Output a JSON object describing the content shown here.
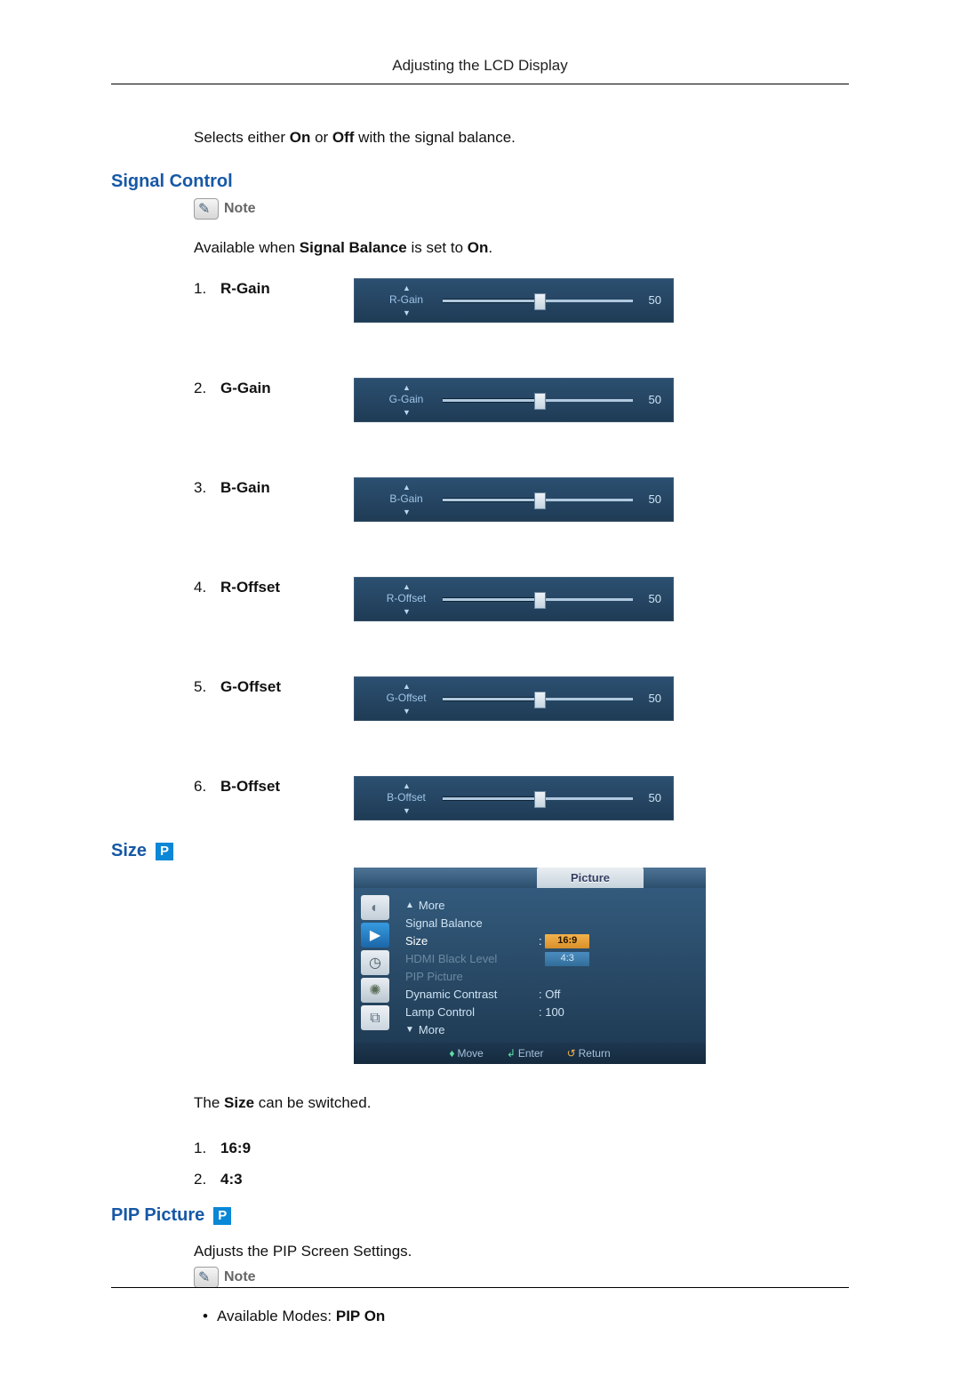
{
  "header": {
    "title": "Adjusting the LCD Display"
  },
  "intro": {
    "prefix": "Selects either ",
    "on": "On",
    "mid": " or ",
    "off": "Off",
    "suffix": " with the signal balance."
  },
  "signal_control": {
    "heading": "Signal Control",
    "note_label": "Note",
    "avail_prefix": "Available when ",
    "avail_bold": "Signal Balance",
    "avail_mid": " is set to ",
    "avail_on": "On",
    "avail_end": ".",
    "items": [
      {
        "n": "1.",
        "name": "R-Gain",
        "label": "R-Gain",
        "value": "50"
      },
      {
        "n": "2.",
        "name": "G-Gain",
        "label": "G-Gain",
        "value": "50"
      },
      {
        "n": "3.",
        "name": "B-Gain",
        "label": "B-Gain",
        "value": "50"
      },
      {
        "n": "4.",
        "name": "R-Offset",
        "label": "R-Offset",
        "value": "50"
      },
      {
        "n": "5.",
        "name": "G-Offset",
        "label": "G-Offset",
        "value": "50"
      },
      {
        "n": "6.",
        "name": "B-Offset",
        "label": "B-Offset",
        "value": "50"
      }
    ]
  },
  "size": {
    "heading": "Size",
    "badge": "P",
    "osd": {
      "tab": "Picture",
      "rows": {
        "more_up": "More",
        "signal_balance": "Signal Balance",
        "size": "Size",
        "size_val": "16:9",
        "hdmi": "HDMI Black Level",
        "hdmi_val": "4:3",
        "pip": "PIP Picture",
        "dyn": "Dynamic Contrast",
        "dyn_val": ": Off",
        "lamp": "Lamp Control",
        "lamp_val": ": 100",
        "more_down": "More"
      },
      "footer": {
        "move": "Move",
        "enter": "Enter",
        "return": "Return"
      }
    },
    "desc_prefix": "The ",
    "desc_bold": "Size",
    "desc_suffix": " can be switched.",
    "options": [
      {
        "n": "1.",
        "v": "16:9"
      },
      {
        "n": "2.",
        "v": "4:3"
      }
    ]
  },
  "pip": {
    "heading": "PIP Picture",
    "badge": "P",
    "desc": "Adjusts the PIP Screen Settings.",
    "note_label": "Note",
    "bullet_prefix": "Available Modes: ",
    "bullet_bold": "PIP On"
  }
}
